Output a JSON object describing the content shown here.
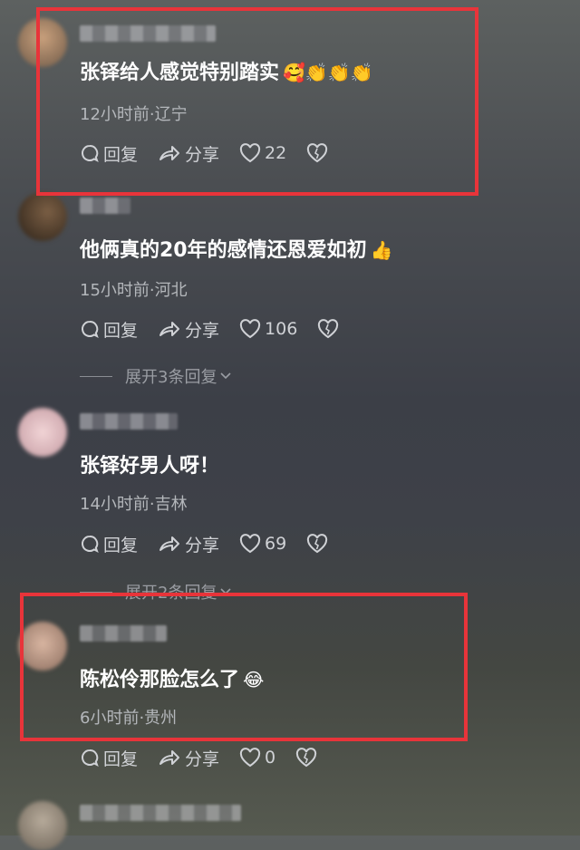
{
  "comments": [
    {
      "text": "张铎给人感觉特别踏实",
      "emoji": "🥰👏👏👏",
      "time": "12小时前·辽宁",
      "reply": "回复",
      "share": "分享",
      "likes": "22"
    },
    {
      "text": "他俩真的20年的感情还恩爱如初",
      "emoji": "👍",
      "time": "15小时前·河北",
      "reply": "回复",
      "share": "分享",
      "likes": "106",
      "expand": "展开3条回复"
    },
    {
      "text": "张铎好男人呀！",
      "emoji": "",
      "time": "14小时前·吉林",
      "reply": "回复",
      "share": "分享",
      "likes": "69",
      "expand": "展开2条回复"
    },
    {
      "text": "陈松伶那脸怎么了",
      "emoji": "😂",
      "time": "6小时前·贵州",
      "reply": "回复",
      "share": "分享",
      "likes": "0"
    }
  ],
  "colors": {
    "highlight": "#e8343a"
  }
}
